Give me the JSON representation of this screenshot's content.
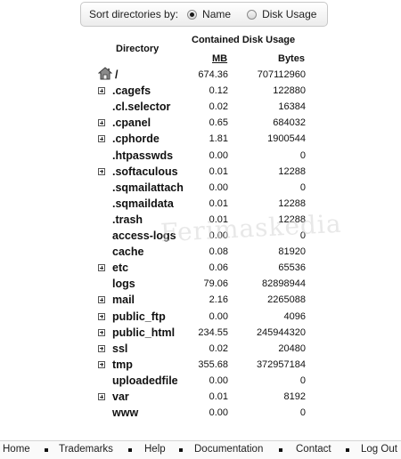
{
  "sort": {
    "label": "Sort directories by:",
    "options": [
      {
        "label": "Name",
        "selected": true
      },
      {
        "label": "Disk Usage",
        "selected": false
      }
    ]
  },
  "table": {
    "col_directory": "Directory",
    "col_usage": "Contained Disk Usage",
    "col_mb": "MB",
    "col_bytes": "Bytes",
    "rows": [
      {
        "name": "/",
        "mb": "674.36",
        "bytes": "707112960",
        "expandable": false,
        "home": true
      },
      {
        "name": ".cagefs",
        "mb": "0.12",
        "bytes": "122880",
        "expandable": true
      },
      {
        "name": ".cl.selector",
        "mb": "0.02",
        "bytes": "16384",
        "expandable": false
      },
      {
        "name": ".cpanel",
        "mb": "0.65",
        "bytes": "684032",
        "expandable": true
      },
      {
        "name": ".cphorde",
        "mb": "1.81",
        "bytes": "1900544",
        "expandable": true
      },
      {
        "name": ".htpasswds",
        "mb": "0.00",
        "bytes": "0",
        "expandable": false
      },
      {
        "name": ".softaculous",
        "mb": "0.01",
        "bytes": "12288",
        "expandable": true
      },
      {
        "name": ".sqmailattach",
        "mb": "0.00",
        "bytes": "0",
        "expandable": false
      },
      {
        "name": ".sqmaildata",
        "mb": "0.01",
        "bytes": "12288",
        "expandable": false
      },
      {
        "name": ".trash",
        "mb": "0.01",
        "bytes": "12288",
        "expandable": false
      },
      {
        "name": "access-logs",
        "mb": "0.00",
        "bytes": "0",
        "expandable": false
      },
      {
        "name": "cache",
        "mb": "0.08",
        "bytes": "81920",
        "expandable": false
      },
      {
        "name": "etc",
        "mb": "0.06",
        "bytes": "65536",
        "expandable": true
      },
      {
        "name": "logs",
        "mb": "79.06",
        "bytes": "82898944",
        "expandable": false
      },
      {
        "name": "mail",
        "mb": "2.16",
        "bytes": "2265088",
        "expandable": true
      },
      {
        "name": "public_ftp",
        "mb": "0.00",
        "bytes": "4096",
        "expandable": true
      },
      {
        "name": "public_html",
        "mb": "234.55",
        "bytes": "245944320",
        "expandable": true
      },
      {
        "name": "ssl",
        "mb": "0.02",
        "bytes": "20480",
        "expandable": true
      },
      {
        "name": "tmp",
        "mb": "355.68",
        "bytes": "372957184",
        "expandable": true
      },
      {
        "name": "uploadedfile",
        "mb": "0.00",
        "bytes": "0",
        "expandable": false
      },
      {
        "name": "var",
        "mb": "0.01",
        "bytes": "8192",
        "expandable": true
      },
      {
        "name": "www",
        "mb": "0.00",
        "bytes": "0",
        "expandable": false
      }
    ]
  },
  "watermark": "Ferimaskedia",
  "footer": {
    "links": [
      "Home",
      "Trademarks",
      "Help",
      "Documentation",
      "Contact",
      "Log Out"
    ]
  }
}
